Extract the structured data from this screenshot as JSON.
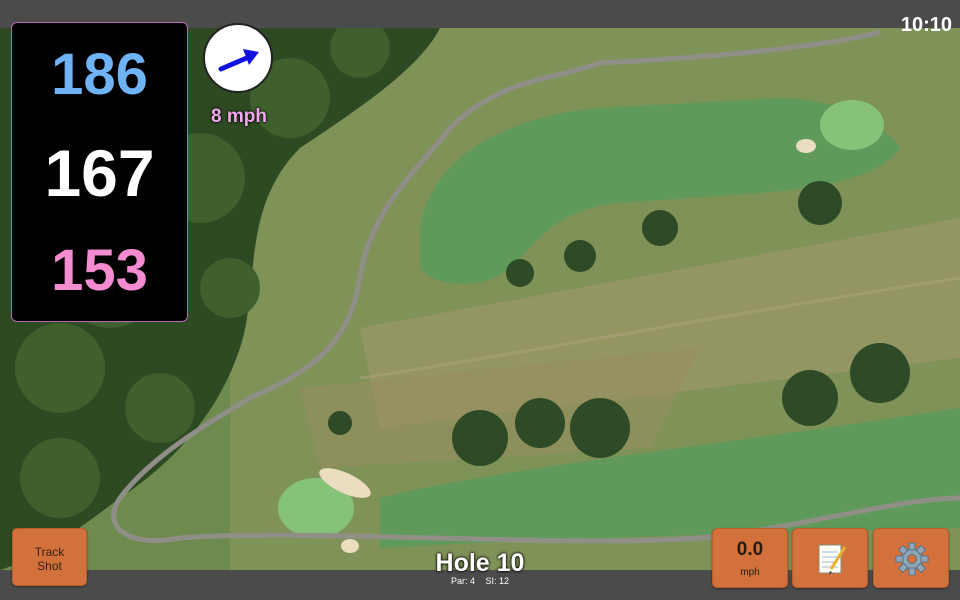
{
  "status_bar": {
    "time": "10:10"
  },
  "yardages": {
    "back": "186",
    "center": "167",
    "front": "153"
  },
  "colors": {
    "back_yardage": "#6fb2f6",
    "center_yardage": "#ffffff",
    "front_yardage": "#f58bd0",
    "button": "#d2713b",
    "wind_arrow": "#1212e0"
  },
  "wind": {
    "speed_label": "8 mph",
    "arrow_icon": "wind-direction-arrow"
  },
  "buttons": {
    "track_shot": [
      "Track",
      "Shot"
    ],
    "wind_value": "0.0",
    "wind_unit": "mph",
    "notes_icon": "notepad-icon",
    "settings_icon": "gear-icon"
  },
  "hole": {
    "title": "Hole 10",
    "par_label": "Par: 4",
    "si_label": "SI: 12"
  }
}
